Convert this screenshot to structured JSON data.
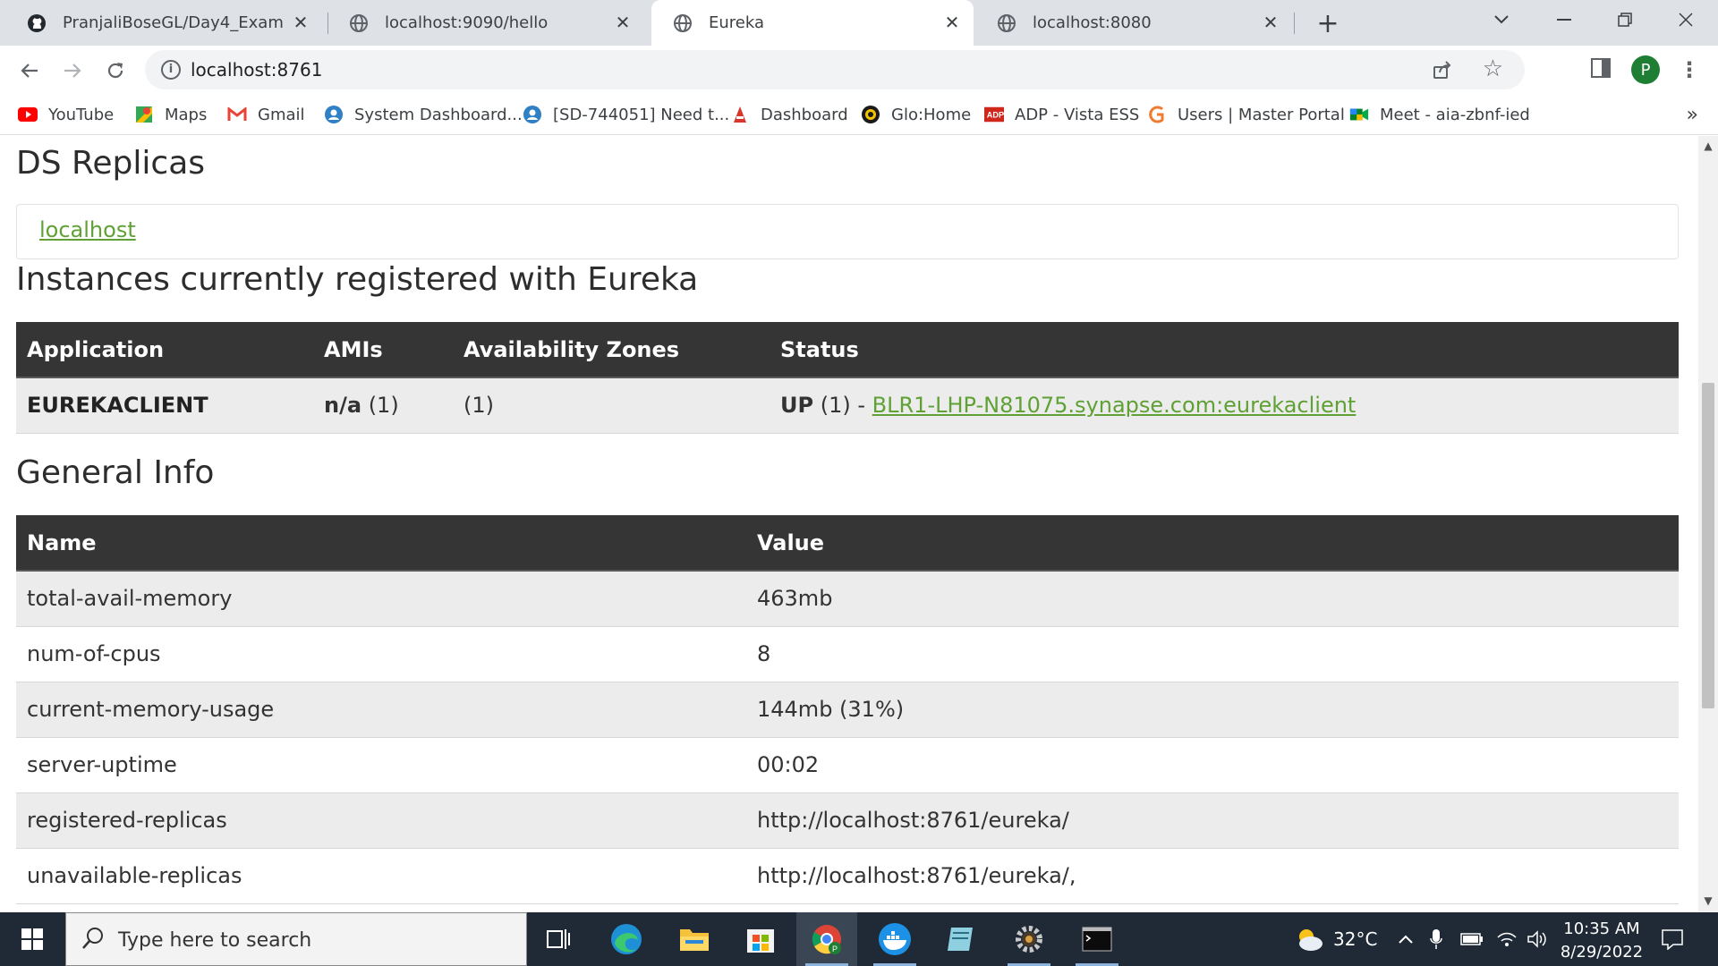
{
  "browser": {
    "tabs": [
      {
        "title": "PranjaliBoseGL/Day4_Exam",
        "icon": "github-icon"
      },
      {
        "title": "localhost:9090/hello",
        "icon": "globe-icon"
      },
      {
        "title": "Eureka",
        "icon": "globe-icon",
        "active": true
      },
      {
        "title": "localhost:8080",
        "icon": "globe-icon"
      }
    ],
    "url": "localhost:8761",
    "profile_initial": "P",
    "bookmarks": [
      {
        "label": "YouTube",
        "icon": "youtube-icon"
      },
      {
        "label": "Maps",
        "icon": "maps-icon"
      },
      {
        "label": "Gmail",
        "icon": "gmail-icon"
      },
      {
        "label": "System Dashboard...",
        "icon": "jira-icon"
      },
      {
        "label": "[SD-744051] Need t...",
        "icon": "jira-icon"
      },
      {
        "label": "Dashboard",
        "icon": "dashboard-icon"
      },
      {
        "label": "Glo:Home",
        "icon": "glo-icon"
      },
      {
        "label": "ADP - Vista ESS",
        "icon": "adp-icon"
      },
      {
        "label": "Users | Master Portal",
        "icon": "portal-icon"
      },
      {
        "label": "Meet - aia-zbnf-ied",
        "icon": "meet-icon"
      }
    ],
    "bookmarks_more": "»"
  },
  "page": {
    "ds_replicas_title": "DS Replicas",
    "replica_link": "localhost",
    "instances_title": "Instances currently registered with Eureka",
    "instances_table": {
      "headers": [
        "Application",
        "AMIs",
        "Availability Zones",
        "Status"
      ],
      "rows": [
        {
          "application": "EUREKACLIENT",
          "amis_label": "n/a",
          "amis_count": "(1)",
          "zones": "(1)",
          "status_prefix": "UP",
          "status_count": "(1) -",
          "status_link": "BLR1-LHP-N81075.synapse.com:eurekaclient"
        }
      ]
    },
    "general_title": "General Info",
    "general_table": {
      "headers": [
        "Name",
        "Value"
      ],
      "rows": [
        [
          "total-avail-memory",
          "463mb"
        ],
        [
          "num-of-cpus",
          "8"
        ],
        [
          "current-memory-usage",
          "144mb (31%)"
        ],
        [
          "server-uptime",
          "00:02"
        ],
        [
          "registered-replicas",
          "http://localhost:8761/eureka/"
        ],
        [
          "unavailable-replicas",
          "http://localhost:8761/eureka/,"
        ]
      ]
    }
  },
  "taskbar": {
    "search_placeholder": "Type here to search",
    "weather": "32°C",
    "time": "10:35 AM",
    "date": "8/29/2022"
  },
  "colors": {
    "link": "#5fa134",
    "table_header": "#353535",
    "taskbar": "#1f2a36"
  }
}
